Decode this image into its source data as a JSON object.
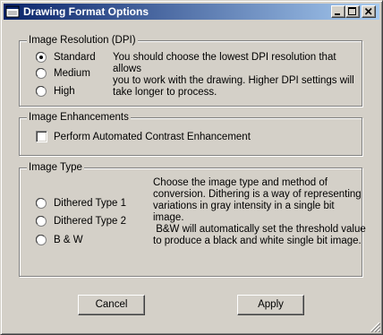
{
  "window": {
    "title": "Drawing Format Options"
  },
  "resolution": {
    "legend": "Image Resolution (DPI)",
    "options": [
      {
        "label": "Standard",
        "selected": true
      },
      {
        "label": "Medium",
        "selected": false
      },
      {
        "label": "High",
        "selected": false
      }
    ],
    "description_lines": [
      "You should choose the lowest DPI resolution that allows",
      "you to work with the drawing.  Higher DPI settings will",
      "take longer to process."
    ]
  },
  "enhancements": {
    "legend": "Image Enhancements",
    "checkbox_label": "Perform Automated Contrast Enhancement",
    "checked": false
  },
  "image_type": {
    "legend": "Image Type",
    "options": [
      {
        "label": "Dithered Type 1",
        "selected": false
      },
      {
        "label": "Dithered Type 2",
        "selected": false
      },
      {
        "label": "B & W",
        "selected": false
      }
    ],
    "description_lines": [
      "Choose the image type and method of",
      "conversion.  Dithering is a way of representing",
      "variations in gray intensity in a single bit image.",
      " B&W will automatically set the threshold value",
      "to produce a black and white single bit image."
    ]
  },
  "buttons": {
    "cancel": "Cancel",
    "apply": "Apply"
  }
}
